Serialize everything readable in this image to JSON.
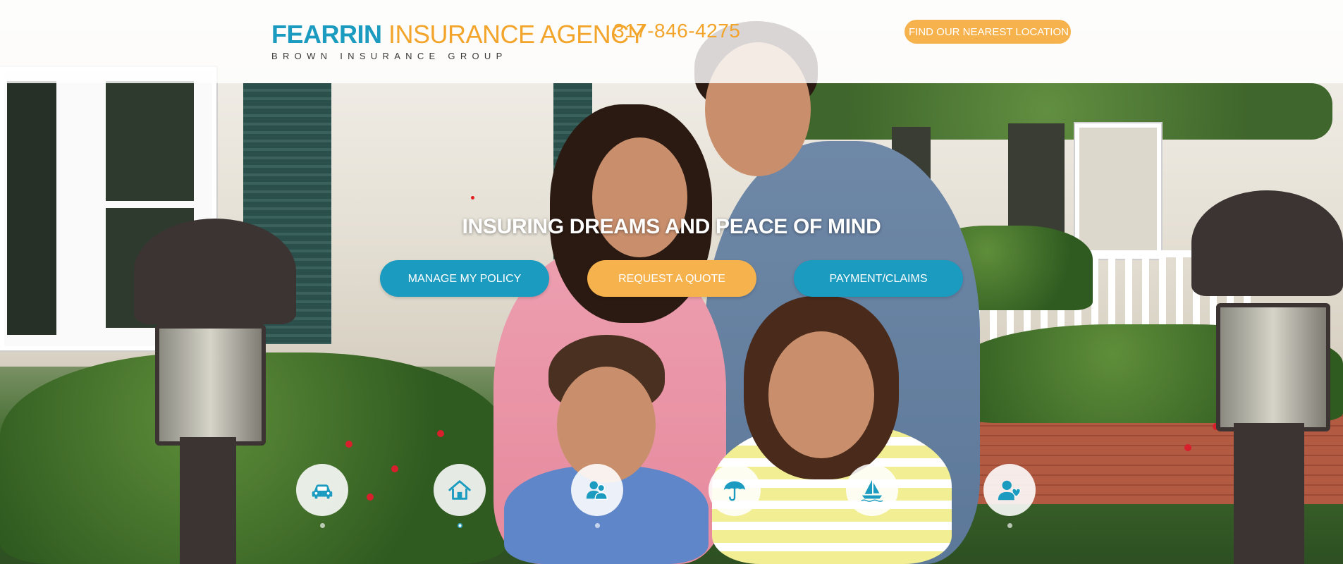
{
  "header": {
    "logo": {
      "name_part1": "FEARRIN",
      "name_part2": "INSURANCE AGENCY",
      "tagline": "BROWN INSURANCE GROUP"
    },
    "phone": "317-846-4275",
    "location_button": "FIND OUR NEAREST LOCATION"
  },
  "hero": {
    "headline": "INSURING DREAMS AND PEACE OF MIND",
    "buttons": [
      {
        "label": "MANAGE MY POLICY"
      },
      {
        "label": "REQUEST A QUOTE"
      },
      {
        "label": "PAYMENT/CLAIMS"
      }
    ]
  },
  "insurance_icons": [
    {
      "icon": "car-icon"
    },
    {
      "icon": "home-icon"
    },
    {
      "icon": "business-people-icon"
    },
    {
      "icon": "umbrella-icon"
    },
    {
      "icon": "boat-icon"
    },
    {
      "icon": "health-person-icon"
    }
  ],
  "slider": {
    "active_index": 1,
    "count": 6
  },
  "colors": {
    "brand_blue": "#1a9bbf",
    "brand_orange": "#f3a52b",
    "button_orange": "#f6b24c"
  }
}
